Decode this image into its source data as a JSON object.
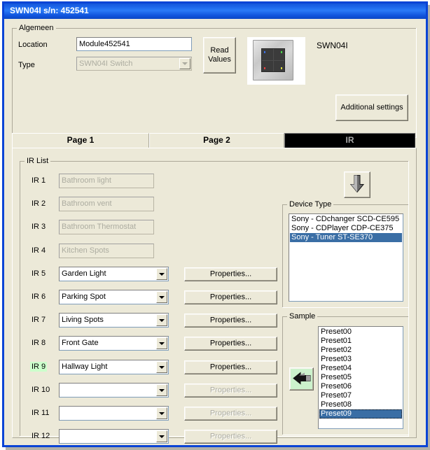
{
  "window": {
    "title": "SWN04I s/n: 452541"
  },
  "general": {
    "group_title": "Algemeen",
    "location_label": "Location",
    "location_value": "Module452541",
    "type_label": "Type",
    "type_value": "SWN04I Switch",
    "read_values_label": "Read\nValues",
    "device_name": "SWN04I",
    "device_image_name": "swn04i-switch-thumbnail",
    "additional_settings_label": "Additional settings"
  },
  "tabs": [
    {
      "label": "Page 1",
      "selected": false
    },
    {
      "label": "Page 2",
      "selected": false
    },
    {
      "label": "IR",
      "selected": true
    }
  ],
  "ir_list": {
    "group_title": "IR List",
    "download_icon": "down-arrow-icon",
    "properties_label": "Properties...",
    "rows": [
      {
        "label": "IR 1",
        "value": "Bathroom light",
        "type": "textbox",
        "enabled": false,
        "properties": false,
        "highlight": false
      },
      {
        "label": "IR 2",
        "value": "Bathroom vent",
        "type": "textbox",
        "enabled": false,
        "properties": false,
        "highlight": false
      },
      {
        "label": "IR 3",
        "value": "Bathroom Thermostat",
        "type": "textbox",
        "enabled": false,
        "properties": false,
        "highlight": false
      },
      {
        "label": "IR 4",
        "value": "Kitchen Spots",
        "type": "textbox",
        "enabled": false,
        "properties": false,
        "highlight": false
      },
      {
        "label": "IR 5",
        "value": "Garden Light",
        "type": "combo",
        "enabled": true,
        "properties": true,
        "highlight": false
      },
      {
        "label": "IR 6",
        "value": "Parking Spot",
        "type": "combo",
        "enabled": true,
        "properties": true,
        "highlight": false
      },
      {
        "label": "IR 7",
        "value": "Living Spots",
        "type": "combo",
        "enabled": true,
        "properties": true,
        "highlight": false
      },
      {
        "label": "IR 8",
        "value": "Front Gate",
        "type": "combo",
        "enabled": true,
        "properties": true,
        "highlight": false
      },
      {
        "label": "IR 9",
        "value": "Hallway Light",
        "type": "combo",
        "enabled": true,
        "properties": true,
        "highlight": true
      },
      {
        "label": "IR 10",
        "value": "",
        "type": "combo",
        "enabled": true,
        "properties": false,
        "highlight": false
      },
      {
        "label": "IR 11",
        "value": "",
        "type": "combo",
        "enabled": true,
        "properties": false,
        "highlight": false
      },
      {
        "label": "IR 12",
        "value": "",
        "type": "combo",
        "enabled": true,
        "properties": false,
        "highlight": false
      }
    ]
  },
  "device_type": {
    "group_title": "Device Type",
    "items": [
      {
        "label": "Sony - CDchanger SCD-CE595",
        "selected": false
      },
      {
        "label": "Sony - CDPlayer CDP-CE375",
        "selected": false
      },
      {
        "label": "Sony - Tuner ST-SE370",
        "selected": true
      }
    ]
  },
  "sample": {
    "group_title": "Sample",
    "transfer_icon": "left-arrow-icon",
    "items": [
      {
        "label": "Preset00",
        "selected": false
      },
      {
        "label": "Preset01",
        "selected": false
      },
      {
        "label": "Preset02",
        "selected": false
      },
      {
        "label": "Preset03",
        "selected": false
      },
      {
        "label": "Preset04",
        "selected": false
      },
      {
        "label": "Preset05",
        "selected": false
      },
      {
        "label": "Preset06",
        "selected": false
      },
      {
        "label": "Preset07",
        "selected": false
      },
      {
        "label": "Preset08",
        "selected": false
      },
      {
        "label": "Preset09",
        "selected": true
      }
    ]
  },
  "colors": {
    "dialog_face": "#ECE9D8",
    "title_blue": "#1B63E8",
    "selection_blue": "#3A6EA5",
    "highlight_green": "#CCFFCC",
    "button_green": "#CCF2CC"
  }
}
